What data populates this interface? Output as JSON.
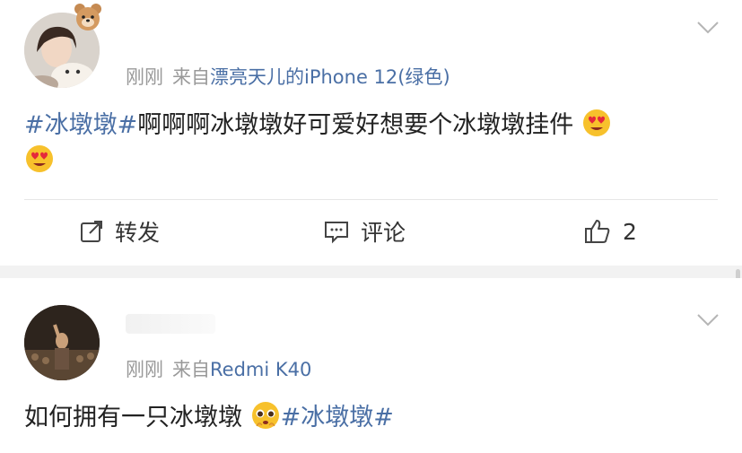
{
  "posts": [
    {
      "time": "刚刚",
      "from": "来自",
      "device": "漂亮天儿的iPhone 12(绿色)",
      "content": {
        "tag": "#冰墩墩#",
        "text": "啊啊啊冰墩墩好可爱好想要个冰墩墩挂件"
      },
      "emojis": [
        "heart-eyes-emoji",
        "heart-eyes-emoji"
      ],
      "actions": {
        "repost_label": "转发",
        "comment_label": "评论",
        "like_count": "2"
      }
    },
    {
      "time": "刚刚",
      "from": "来自",
      "device": "Redmi K40",
      "content": {
        "text": "如何拥有一只冰墩墩",
        "tag": "#冰墩墩#"
      },
      "emojis": [
        "pleading-face-emoji"
      ]
    }
  ],
  "colors": {
    "link": "#4a6fa5",
    "meta": "#999999",
    "separator": "#f2f2f2"
  }
}
